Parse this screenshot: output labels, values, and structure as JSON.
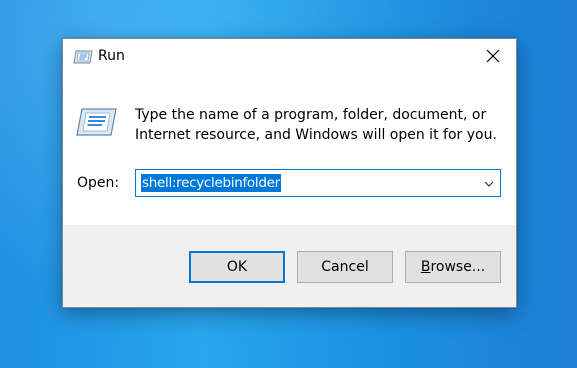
{
  "dialog": {
    "title": "Run",
    "icons": {
      "title_icon": "run-icon",
      "main_icon": "run-icon",
      "close_icon": "close-icon",
      "dropdown_icon": "chevron-down-icon"
    },
    "description": "Type the name of a program, folder, document, or Internet resource, and Windows will open it for you.",
    "open_label": "Open:",
    "open_value": "shell:recyclebinfolder",
    "buttons": {
      "ok": "OK",
      "cancel": "Cancel",
      "browse": "Browse..."
    }
  },
  "colors": {
    "accent": "#0078d7",
    "desktop": "#1f8fe2",
    "footer": "#f0f0f0",
    "button": "#e1e1e1"
  }
}
